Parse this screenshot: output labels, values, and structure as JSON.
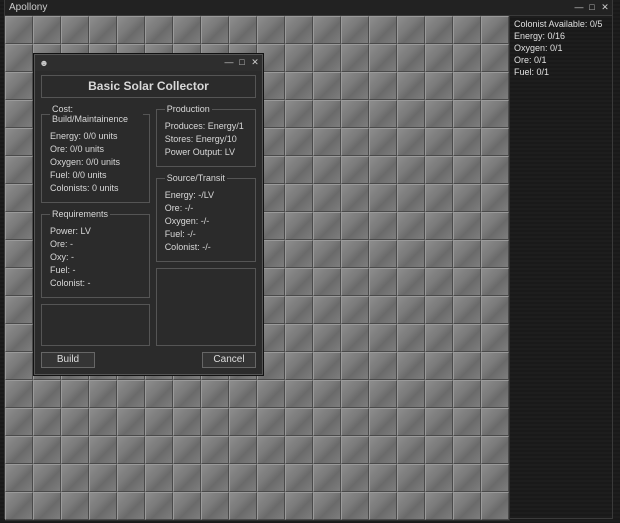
{
  "mainWindow": {
    "title": "Apollony",
    "controls": {
      "min": "—",
      "max": "□",
      "close": "✕"
    }
  },
  "sidePanel": {
    "colonist": "Colonist Available: 0/5",
    "energy": "Energy: 0/16",
    "oxygen": "Oxygen: 0/1",
    "ore": "Ore: 0/1",
    "fuel": "Fuel: 0/1"
  },
  "dialog": {
    "icon": "☻",
    "controls": {
      "min": "—",
      "max": "□",
      "close": "✕"
    },
    "title": "Basic Solar Collector",
    "cost": {
      "legend": "Cost: Build/Maintainence",
      "energy": "Energy: 0/0 units",
      "ore": "Ore: 0/0 units",
      "oxygen": "Oxygen: 0/0 units",
      "fuel": "Fuel: 0/0 units",
      "colonists": "Colonists: 0 units"
    },
    "requirements": {
      "legend": "Requirements",
      "power": "Power: LV",
      "ore": "Ore: -",
      "oxy": "Oxy: -",
      "fuel": "Fuel: -",
      "colonist": "Colonist: -"
    },
    "production": {
      "legend": "Production",
      "produces": "Produces: Energy/1",
      "stores": "Stores: Energy/10",
      "power": "Power Output: LV"
    },
    "transit": {
      "legend": "Source/Transit",
      "energy": "Energy: -/LV",
      "ore": "Ore: -/-",
      "oxygen": "Oxygen: -/-",
      "fuel": "Fuel: -/-",
      "colonist": "Colonist: -/-"
    },
    "buttons": {
      "build": "Build",
      "cancel": "Cancel"
    }
  }
}
